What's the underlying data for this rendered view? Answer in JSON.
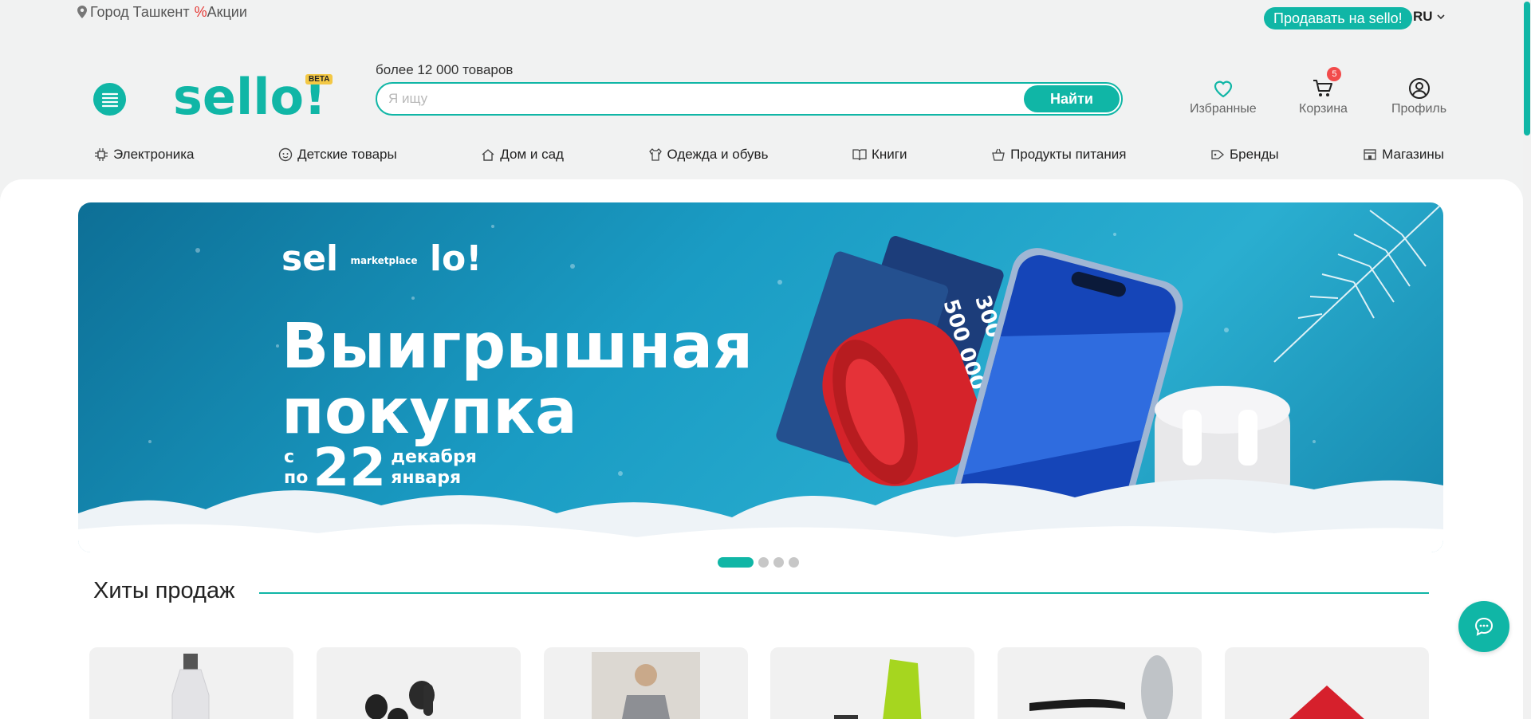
{
  "topbar": {
    "city": "Город Ташкент",
    "promo_symbol": "%",
    "promo_label": "Акции",
    "sell_button": "Продавать на sello!",
    "language": "RU"
  },
  "header": {
    "logo_text": "sello!",
    "beta_badge": "BETA",
    "search_hint": "более 12 000 товаров",
    "search_placeholder": "Я ищу",
    "search_value": "",
    "find_button": "Найти",
    "favorites_label": "Избранные",
    "cart_label": "Корзина",
    "cart_count": "5",
    "profile_label": "Профиль"
  },
  "categories": [
    {
      "label": "Электроника",
      "icon": "chip-icon"
    },
    {
      "label": "Детские товары",
      "icon": "baby-face-icon"
    },
    {
      "label": "Дом и сад",
      "icon": "house-icon"
    },
    {
      "label": "Одежда и обувь",
      "icon": "clothing-icon"
    },
    {
      "label": "Книги",
      "icon": "book-icon"
    },
    {
      "label": "Продукты питания",
      "icon": "groceries-icon"
    },
    {
      "label": "Бренды",
      "icon": "brand-tag-icon"
    },
    {
      "label": "Магазины",
      "icon": "store-icon"
    }
  ],
  "banner": {
    "brand_left": "sel",
    "brand_mid": "marketplace",
    "brand_right": "lo!",
    "headline_1": "Выигрышная",
    "headline_2": "покупка",
    "date_from_label": "с",
    "date_to_label": "по",
    "date_number": "22",
    "month_1": "декабря",
    "month_2": "января",
    "voucher_1": "300 000",
    "voucher_2": "500 000 UZS",
    "slide_count": 4,
    "active_slide": 1
  },
  "sections": {
    "hits_title": "Хиты продаж"
  },
  "colors": {
    "accent": "#10b6a6",
    "badge_red": "#f24b4b",
    "beta_yellow": "#f3c845",
    "background": "#f1f2f2"
  }
}
